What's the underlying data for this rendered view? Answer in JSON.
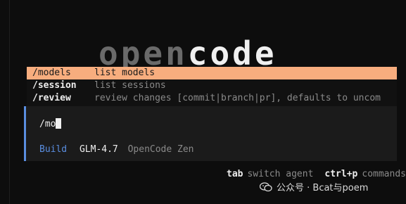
{
  "logo": {
    "part_dim": "open",
    "part_bright": "code"
  },
  "menu": {
    "items": [
      {
        "command": "/models",
        "description": "list models",
        "selected": true
      },
      {
        "command": "/session",
        "description": "list sessions",
        "selected": false
      },
      {
        "command": "/review",
        "description": "review changes [commit|branch|pr], defaults to uncom",
        "selected": false
      }
    ]
  },
  "prompt": {
    "input_value": "/mo",
    "agent": "Build",
    "model": "GLM-4.7",
    "provider": "OpenCode Zen"
  },
  "footer": {
    "hints": [
      {
        "key": "tab",
        "label": "switch agent"
      },
      {
        "key": "ctrl+p",
        "label": "commands"
      }
    ]
  },
  "watermark": {
    "text": "公众号 · Bcat与poem"
  },
  "colors": {
    "background": "#0d0d0d",
    "selection": "#f7ad7e",
    "agent_accent": "#5a8ee0",
    "muted": "#8a8a8a"
  },
  "icons": {
    "watermark_icon": "wechat-icon"
  }
}
